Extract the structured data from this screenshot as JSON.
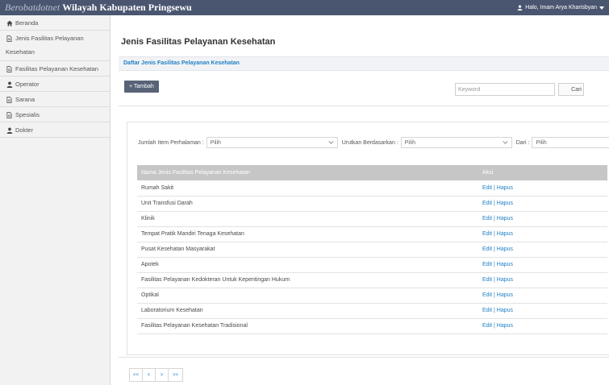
{
  "navbar": {
    "brand_italic": "Berobatdotnet",
    "brand_bold": "Wilayah Kabupaten Pringsewu",
    "user_label": "Halo, Imam Arya Kharisbyan"
  },
  "sidebar": {
    "items": [
      {
        "label": "Beranda",
        "icon": "home-icon"
      },
      {
        "label_line1": "Jenis Fasilitas Pelayanan",
        "label_line2": "Kesehatan",
        "icon": "document-icon"
      },
      {
        "label": "Fasilitas Pelayanan Kesehatan",
        "icon": "document-icon"
      },
      {
        "label": "Operator",
        "icon": "user-icon"
      },
      {
        "label": "Sarana",
        "icon": "document-icon"
      },
      {
        "label": "Spesialis",
        "icon": "document-icon"
      },
      {
        "label": "Dokter",
        "icon": "user-icon"
      }
    ]
  },
  "main": {
    "title": "Jenis Fasilitas Pelayanan Kesehatan",
    "subtitle": "Daftar Jenis Fasilitas Pelayanan Kesehatan",
    "add_button": "+ Tambah",
    "search_placeholder": "Keyword",
    "search_button": "Cari"
  },
  "filters": {
    "per_page_label": "Jumlah Item Perhalaman :",
    "per_page_value": "Pilih",
    "sort_label": "Urutkan Berdasarkan :",
    "sort_value": "Pilih",
    "order_label": "Dari :",
    "order_value": "Pilih"
  },
  "table": {
    "columns": [
      "Nama Jenis Fasilitas Pelayanan Kesehatan",
      "Aksi"
    ],
    "edit_label": "Edit",
    "delete_label": "Hapus",
    "separator": "|",
    "rows": [
      "Rumah Sakit",
      "Unit Transfusi Darah",
      "Klinik",
      "Tempat Pratik Mandiri Tenaga Kesehatan",
      "Pusat Kesehatan Masyarakat",
      "Apotek",
      "Fasilitas Pelayanan Kedokteran Untuk Kepentingan Hukum",
      "Optikal",
      "Laboratorium Kesehatan",
      "Fasilitas Pelayanan Kesehatan Tradisional"
    ]
  },
  "pagination": {
    "first": "<<",
    "prev": "<",
    "next": ">",
    "last": ">>"
  },
  "colors": {
    "navbar": "#4a5670",
    "link": "#1f7fc4",
    "table_header": "#c6c6c6",
    "add_button": "#596378"
  }
}
